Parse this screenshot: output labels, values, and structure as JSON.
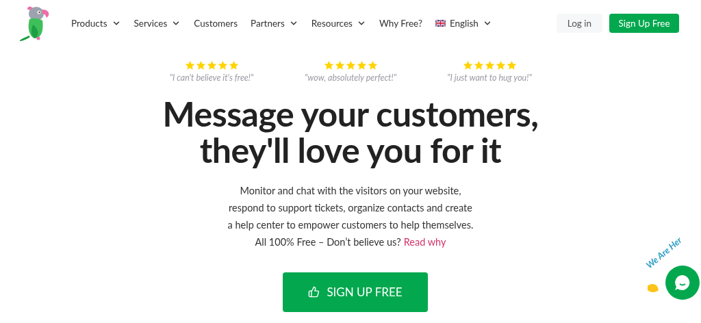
{
  "nav": {
    "items": [
      {
        "label": "Products",
        "kind": "menu"
      },
      {
        "label": "Services",
        "kind": "menu"
      },
      {
        "label": "Customers",
        "kind": "link"
      },
      {
        "label": "Partners",
        "kind": "menu"
      },
      {
        "label": "Resources",
        "kind": "menu"
      },
      {
        "label": "Why Free?",
        "kind": "link"
      },
      {
        "label": "English",
        "kind": "language"
      }
    ],
    "login": "Log in",
    "signup": "Sign Up Free"
  },
  "reviews": [
    {
      "stars": 5,
      "quote": "\"I can't believe it's free!\""
    },
    {
      "stars": 5,
      "quote": "\"wow, absolutely perfect!\""
    },
    {
      "stars": 5,
      "quote": "\"I just want to hug you!\""
    }
  ],
  "headline": [
    "Message your customers,",
    "they'll love you for it"
  ],
  "description": [
    "Monitor and chat with the visitors on your website,",
    "respond to support tickets, organize contacts and create",
    "a help center to empower customers to help themselves."
  ],
  "note": "All 100% Free – Don’t believe us?",
  "note_link": "Read why",
  "cta": "SIGN UP FREE",
  "chat_widget": {
    "label": "We Are Her"
  }
}
